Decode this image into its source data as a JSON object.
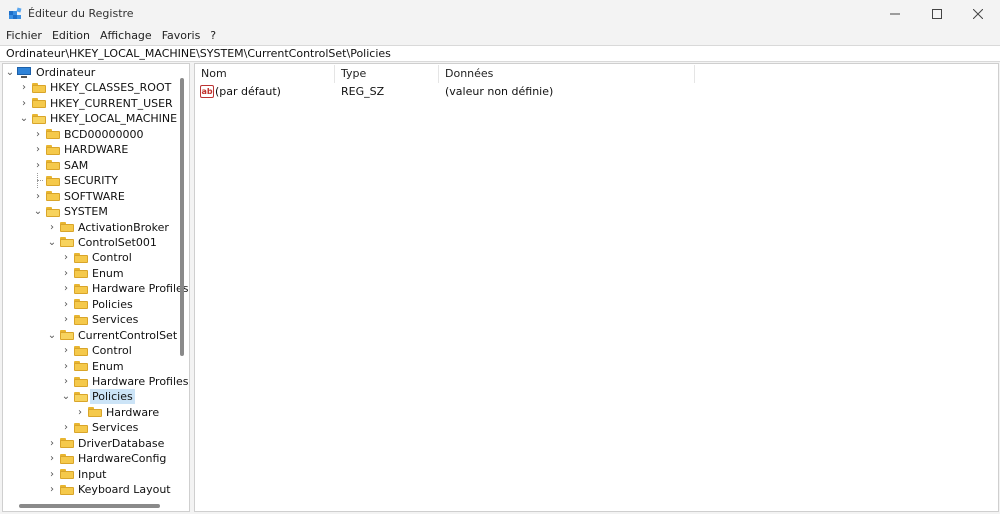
{
  "window": {
    "title": "Éditeur du Registre",
    "controls": {
      "minimize": "—",
      "maximize": "☐",
      "close": "✕"
    }
  },
  "menu": [
    "Fichier",
    "Edition",
    "Affichage",
    "Favoris",
    "?"
  ],
  "address": "Ordinateur\\HKEY_LOCAL_MACHINE\\SYSTEM\\CurrentControlSet\\Policies",
  "tree": {
    "root": "Ordinateur",
    "nodes": [
      {
        "label": "HKEY_CLASSES_ROOT",
        "state": "collapsed"
      },
      {
        "label": "HKEY_CURRENT_USER",
        "state": "collapsed"
      },
      {
        "label": "HKEY_LOCAL_MACHINE",
        "state": "expanded"
      },
      {
        "label": "BCD00000000",
        "state": "collapsed"
      },
      {
        "label": "HARDWARE",
        "state": "collapsed"
      },
      {
        "label": "SAM",
        "state": "collapsed"
      },
      {
        "label": "SECURITY",
        "state": "leaf"
      },
      {
        "label": "SOFTWARE",
        "state": "collapsed"
      },
      {
        "label": "SYSTEM",
        "state": "expanded"
      },
      {
        "label": "ActivationBroker",
        "state": "collapsed"
      },
      {
        "label": "ControlSet001",
        "state": "expanded"
      },
      {
        "label": "Control",
        "state": "collapsed"
      },
      {
        "label": "Enum",
        "state": "collapsed"
      },
      {
        "label": "Hardware Profiles",
        "state": "collapsed"
      },
      {
        "label": "Policies",
        "state": "collapsed"
      },
      {
        "label": "Services",
        "state": "collapsed"
      },
      {
        "label": "CurrentControlSet",
        "state": "expanded"
      },
      {
        "label": "Control",
        "state": "collapsed"
      },
      {
        "label": "Enum",
        "state": "collapsed"
      },
      {
        "label": "Hardware Profiles",
        "state": "collapsed"
      },
      {
        "label": "Policies",
        "state": "expanded",
        "selected": true
      },
      {
        "label": "Hardware",
        "state": "collapsed"
      },
      {
        "label": "Services",
        "state": "collapsed"
      },
      {
        "label": "DriverDatabase",
        "state": "collapsed"
      },
      {
        "label": "HardwareConfig",
        "state": "collapsed"
      },
      {
        "label": "Input",
        "state": "collapsed"
      },
      {
        "label": "Keyboard Layout",
        "state": "collapsed"
      }
    ]
  },
  "list": {
    "columns": [
      "Nom",
      "Type",
      "Données"
    ],
    "rows": [
      {
        "icon": "string-value-icon",
        "icon_text": "ab",
        "name": "(par défaut)",
        "type": "REG_SZ",
        "data": "(valeur non définie)"
      }
    ]
  },
  "colors": {
    "selection": "#cce4f7",
    "folder": "#f5c94b",
    "accent": "#2f83d8"
  }
}
